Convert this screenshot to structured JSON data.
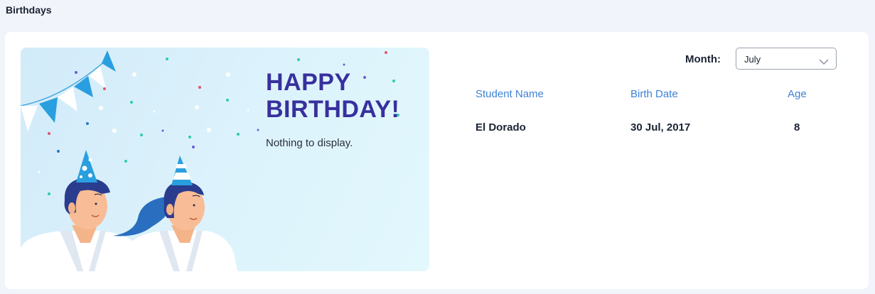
{
  "page": {
    "title": "Birthdays"
  },
  "banner": {
    "headline_line1": "HAPPY",
    "headline_line2": "BIRTHDAY!",
    "empty_message": "Nothing to display.",
    "illustration": "two-students-party-hats-bunting-confetti"
  },
  "filter": {
    "label": "Month:",
    "selected": "July",
    "icon": "chevron-down-icon"
  },
  "table": {
    "columns": [
      "Student Name",
      "Birth Date",
      "Age"
    ],
    "rows": [
      {
        "name": "El Dorado",
        "birth_date": "30 Jul, 2017",
        "age": "8"
      }
    ]
  },
  "colors": {
    "accent": "#3d82d6",
    "headline": "#38309e",
    "background": "#f1f4fa"
  }
}
